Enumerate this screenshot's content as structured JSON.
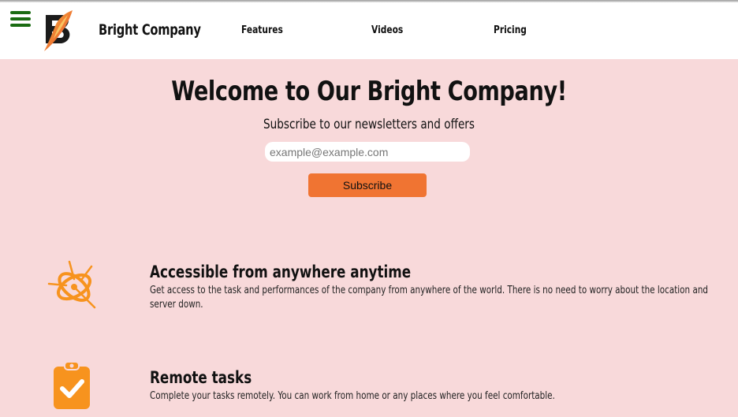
{
  "header": {
    "brand": "Bright Company",
    "nav": [
      {
        "label": "Features"
      },
      {
        "label": "Videos"
      },
      {
        "label": "Pricing"
      }
    ]
  },
  "hero": {
    "title": "Welcome to Our Bright Company!",
    "subtitle": "Subscribe to our newsletters and offers",
    "email_placeholder": "example@example.com",
    "subscribe_label": "Subscribe"
  },
  "features": [
    {
      "icon": "network-globe-icon",
      "title": "Accessible from anywhere anytime",
      "description": "Get access to the task and performances of the company from anywhere of the world. There is no need to worry about the location and server down."
    },
    {
      "icon": "clipboard-check-icon",
      "title": "Remote tasks",
      "description": "Complete your tasks remotely. You can work from home or any places where you feel comfortable."
    }
  ],
  "colors": {
    "page_background": "#f8d9da",
    "accent": "#f07432",
    "hamburger": "#1a6b12",
    "icon": "#f7931e"
  }
}
